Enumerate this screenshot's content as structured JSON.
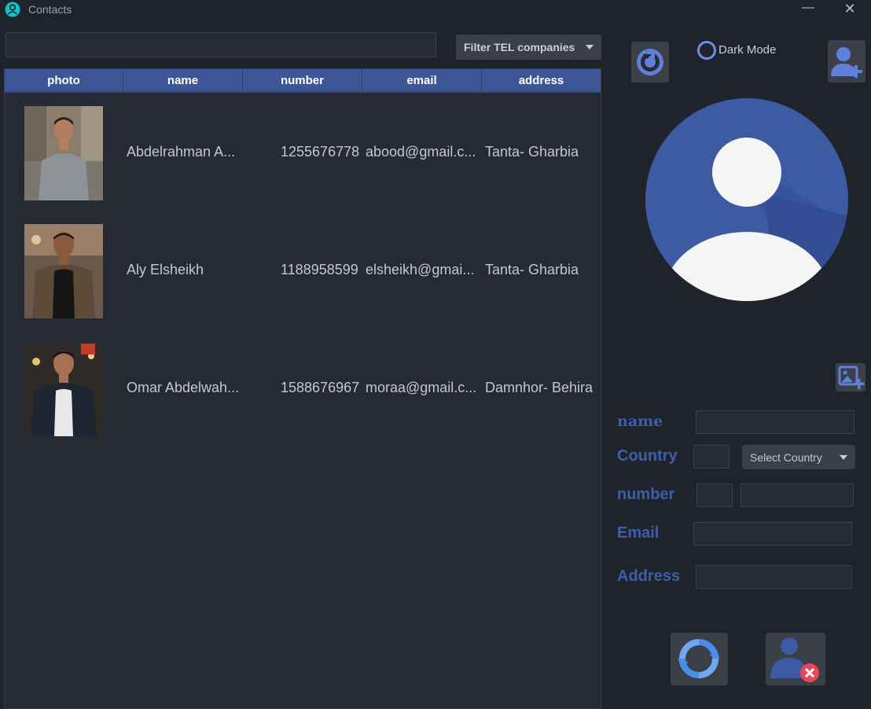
{
  "window": {
    "title": "Contacts",
    "minimize_glyph": "—",
    "close_glyph": "✕"
  },
  "search": {
    "value": "",
    "placeholder": ""
  },
  "filter": {
    "label": "Filter TEL companies"
  },
  "table": {
    "columns": [
      "photo",
      "name",
      "number",
      "email",
      "address"
    ],
    "rows": [
      {
        "name": "Abdelrahman A...",
        "number": "1255676778",
        "email": "abood@gmail.c...",
        "address": "Tanta- Gharbia"
      },
      {
        "name": "Aly Elsheikh",
        "number": "1188958599",
        "email": "elsheikh@gmai...",
        "address": "Tanta- Gharbia"
      },
      {
        "name": "Omar Abdelwah...",
        "number": "1588676967",
        "email": "moraa@gmail.c...",
        "address": "Damnhor- Behira"
      }
    ]
  },
  "right_panel": {
    "dark_mode_label": "Dark Mode",
    "form": {
      "name_label": "name",
      "country_label": "Country",
      "number_label": "number",
      "email_label": "Email",
      "address_label": "Address",
      "country_select_label": "Select Country"
    }
  },
  "colors": {
    "background": "#1f232b",
    "header_blue": "#3d5796",
    "label_blue": "#3f5ea8",
    "accent_blue": "#6b8fe0",
    "button_gray": "#3a3f48",
    "delete_red": "#e8455b"
  },
  "icons": {
    "app": "contacts-app-icon",
    "reload": "reload-icon",
    "add_contact": "add-contact-icon",
    "add_image": "add-image-icon",
    "update": "sync-icon",
    "delete": "delete-contact-icon"
  }
}
